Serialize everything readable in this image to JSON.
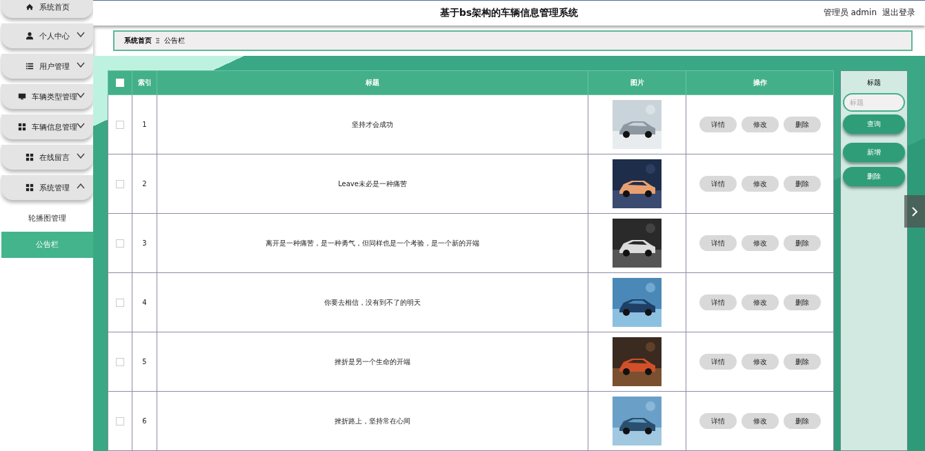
{
  "header": {
    "title": "基于bs架构的车辆信息管理系统",
    "user": "管理员 admin",
    "logout": "退出登录"
  },
  "sidebar": {
    "items": [
      {
        "label": "系统首页",
        "kind": "link"
      },
      {
        "label": "个人中心",
        "kind": "menu",
        "expanded": false
      },
      {
        "label": "用户管理",
        "kind": "menu",
        "expanded": false
      },
      {
        "label": "车辆类型管理",
        "kind": "menu",
        "expanded": false
      },
      {
        "label": "车辆信息管理",
        "kind": "menu",
        "expanded": false
      },
      {
        "label": "在线留言",
        "kind": "menu",
        "expanded": false
      },
      {
        "label": "系统管理",
        "kind": "menu",
        "expanded": true,
        "children": [
          {
            "label": "轮播图管理",
            "selected": false
          },
          {
            "label": "公告栏",
            "selected": true
          }
        ]
      }
    ]
  },
  "breadcrumb": [
    "系统首页",
    "公告栏"
  ],
  "table": {
    "select_all": {
      "checked": false
    },
    "columns": [
      "索引",
      "标题",
      "图片",
      "操作"
    ],
    "rows": [
      {
        "checked": false,
        "index": "1",
        "title": "坚持才会成功",
        "image": {
          "kind": "picture"
        },
        "actions": [
          "详情",
          "修改",
          "删除"
        ]
      },
      {
        "checked": false,
        "index": "2",
        "title": "Leave未必是一种痛苦",
        "image": {
          "kind": "picture"
        },
        "actions": [
          "详情",
          "修改",
          "删除"
        ]
      },
      {
        "checked": false,
        "index": "3",
        "title": "离开是一种痛苦，是一种勇气，但同样也是一个考验，是一个新的开端",
        "image": {
          "kind": "picture"
        },
        "actions": [
          "详情",
          "修改",
          "删除"
        ]
      },
      {
        "checked": false,
        "index": "4",
        "title": "你要去相信，没有到不了的明天",
        "image": {
          "kind": "picture"
        },
        "actions": [
          "详情",
          "修改",
          "删除"
        ]
      },
      {
        "checked": false,
        "index": "5",
        "title": "挫折是另一个生命的开端",
        "image": {
          "kind": "picture"
        },
        "actions": [
          "详情",
          "修改",
          "删除"
        ]
      },
      {
        "checked": false,
        "index": "6",
        "title": "挫折路上，坚持常在心间",
        "image": {
          "kind": "picture"
        },
        "actions": [
          "详情",
          "修改",
          "删除"
        ]
      }
    ]
  },
  "search_panel": {
    "label": "标题",
    "placeholder": "标题",
    "buttons": [
      "查询",
      "新增",
      "删除"
    ]
  }
}
